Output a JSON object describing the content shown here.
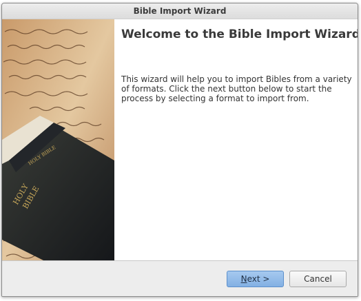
{
  "window": {
    "title": "Bible Import Wizard"
  },
  "page": {
    "heading": "Welcome to the Bible Import Wizard",
    "description": "This wizard will help you to import Bibles from a variety of formats. Click the next button below to start the process by selecting a format to import from."
  },
  "image": {
    "book_spine_title": "HOLY BIBLE",
    "cover_line1": "HOLY",
    "cover_line2": "BIBLE"
  },
  "buttons": {
    "next_mnemonic": "N",
    "next_rest": "ext >",
    "cancel_label": "Cancel"
  },
  "colors": {
    "accent": "#83b0e3",
    "background": "#ededed"
  }
}
